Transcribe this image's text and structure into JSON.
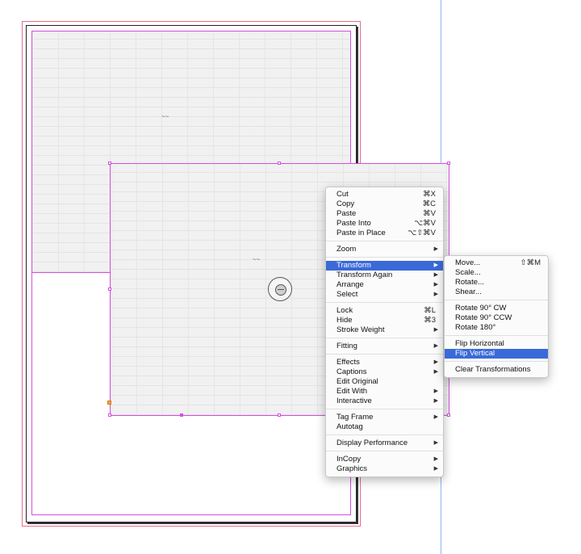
{
  "context_menu": {
    "groups": [
      [
        {
          "label": "Cut",
          "shortcut": "⌘X"
        },
        {
          "label": "Copy",
          "shortcut": "⌘C"
        },
        {
          "label": "Paste",
          "shortcut": "⌘V"
        },
        {
          "label": "Paste Into",
          "shortcut": "⌥⌘V"
        },
        {
          "label": "Paste in Place",
          "shortcut": "⌥⇧⌘V"
        }
      ],
      [
        {
          "label": "Zoom",
          "submenu": true
        }
      ],
      [
        {
          "label": "Transform",
          "submenu": true,
          "highlighted": true
        },
        {
          "label": "Transform Again",
          "submenu": true
        },
        {
          "label": "Arrange",
          "submenu": true
        },
        {
          "label": "Select",
          "submenu": true
        }
      ],
      [
        {
          "label": "Lock",
          "shortcut": "⌘L"
        },
        {
          "label": "Hide",
          "shortcut": "⌘3"
        },
        {
          "label": "Stroke Weight",
          "submenu": true
        }
      ],
      [
        {
          "label": "Fitting",
          "submenu": true
        }
      ],
      [
        {
          "label": "Effects",
          "submenu": true
        },
        {
          "label": "Captions",
          "submenu": true
        },
        {
          "label": "Edit Original"
        },
        {
          "label": "Edit With",
          "submenu": true
        },
        {
          "label": "Interactive",
          "submenu": true
        }
      ],
      [
        {
          "label": "Tag Frame",
          "submenu": true
        },
        {
          "label": "Autotag"
        }
      ],
      [
        {
          "label": "Display Performance",
          "submenu": true
        }
      ],
      [
        {
          "label": "InCopy",
          "submenu": true
        },
        {
          "label": "Graphics",
          "submenu": true
        }
      ]
    ]
  },
  "transform_submenu": {
    "groups": [
      [
        {
          "label": "Move...",
          "shortcut": "⇧⌘M"
        },
        {
          "label": "Scale..."
        },
        {
          "label": "Rotate..."
        },
        {
          "label": "Shear..."
        }
      ],
      [
        {
          "label": "Rotate 90° CW"
        },
        {
          "label": "Rotate 90° CCW"
        },
        {
          "label": "Rotate 180°"
        }
      ],
      [
        {
          "label": "Flip Horizontal"
        },
        {
          "label": "Flip Vertical",
          "highlighted": true
        }
      ],
      [
        {
          "label": "Clear Transformations"
        }
      ]
    ]
  },
  "colors": {
    "highlight": "#3a6ad8",
    "frame_magenta": "#d34fe0",
    "bleed_red": "#e86b8c",
    "guide_blue": "#8fb6ee"
  }
}
